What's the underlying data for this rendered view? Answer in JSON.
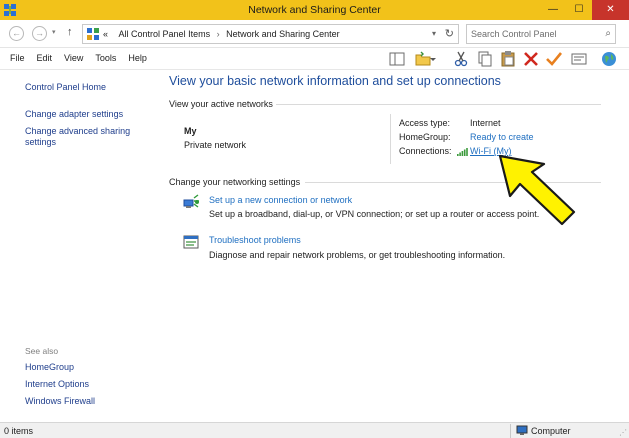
{
  "window": {
    "title": "Network and Sharing Center",
    "minimize_glyph": "—",
    "maximize_glyph": "☐",
    "close_glyph": "✕"
  },
  "nav": {
    "back_glyph": "←",
    "forward_glyph": "→",
    "dropdown_glyph": "▾",
    "up_glyph": "↑",
    "address_prefix": "«",
    "breadcrumb": [
      "All Control Panel Items",
      "Network and Sharing Center"
    ],
    "breadcrumb_sep": "›",
    "address_dropdown_glyph": "▾",
    "refresh_glyph": "↻",
    "search_placeholder": "Search Control Panel",
    "search_glyph": "⌕"
  },
  "menu": [
    "File",
    "Edit",
    "View",
    "Tools",
    "Help"
  ],
  "toolbar_icons": [
    "layout-icon",
    "folder-options-icon",
    "cut-icon",
    "copy-icon",
    "paste-icon",
    "delete-icon",
    "check-icon",
    "properties-icon",
    "globe-icon"
  ],
  "sidebar": {
    "home": "Control Panel Home",
    "adapter": "Change adapter settings",
    "advanced": "Change advanced sharing settings",
    "see_also": "See also",
    "links": [
      "HomeGroup",
      "Internet Options",
      "Windows Firewall"
    ]
  },
  "main": {
    "heading": "View your basic network information and set up connections",
    "active_networks_label": "View your active networks",
    "network_name": "My",
    "network_type": "Private network",
    "access_type_label": "Access type:",
    "access_type_value": "Internet",
    "homegroup_label": "HomeGroup:",
    "homegroup_value": "Ready to create",
    "connections_label": "Connections:",
    "connections_value": "Wi-Fi (My)",
    "change_settings_label": "Change your networking settings",
    "tasks": [
      {
        "link": "Set up a new connection or network",
        "desc": "Set up a broadband, dial-up, or VPN connection; or set up a router or access point."
      },
      {
        "link": "Troubleshoot problems",
        "desc": "Diagnose and repair network problems, or get troubleshooting information."
      }
    ]
  },
  "status": {
    "items": "0 items",
    "computer": "Computer",
    "grip_glyph": "⋰"
  },
  "colors": {
    "title_bar": "#f2c21a",
    "close_button": "#c7342b",
    "link": "#1f6fc1",
    "heading": "#1f4e9c",
    "arrow_fill": "#fff200"
  }
}
